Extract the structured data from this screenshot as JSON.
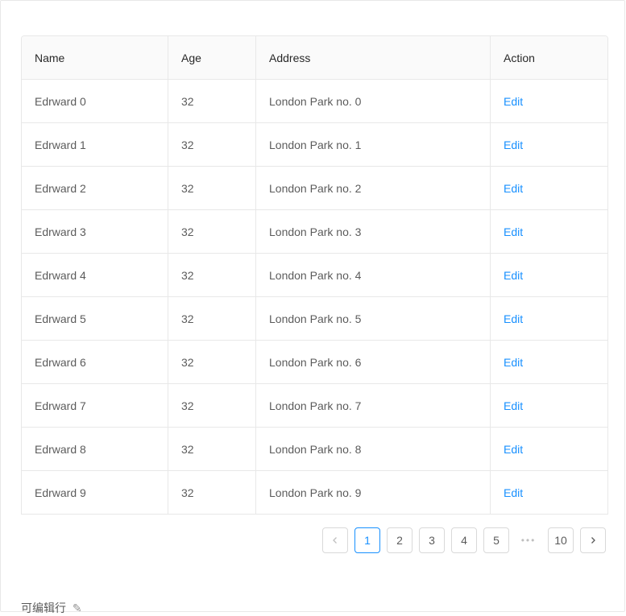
{
  "table": {
    "columns": [
      "Name",
      "Age",
      "Address",
      "Action"
    ],
    "rows": [
      {
        "name": "Edrward 0",
        "age": "32",
        "address": "London Park no. 0",
        "action": "Edit"
      },
      {
        "name": "Edrward 1",
        "age": "32",
        "address": "London Park no. 1",
        "action": "Edit"
      },
      {
        "name": "Edrward 2",
        "age": "32",
        "address": "London Park no. 2",
        "action": "Edit"
      },
      {
        "name": "Edrward 3",
        "age": "32",
        "address": "London Park no. 3",
        "action": "Edit"
      },
      {
        "name": "Edrward 4",
        "age": "32",
        "address": "London Park no. 4",
        "action": "Edit"
      },
      {
        "name": "Edrward 5",
        "age": "32",
        "address": "London Park no. 5",
        "action": "Edit"
      },
      {
        "name": "Edrward 6",
        "age": "32",
        "address": "London Park no. 6",
        "action": "Edit"
      },
      {
        "name": "Edrward 7",
        "age": "32",
        "address": "London Park no. 7",
        "action": "Edit"
      },
      {
        "name": "Edrward 8",
        "age": "32",
        "address": "London Park no. 8",
        "action": "Edit"
      },
      {
        "name": "Edrward 9",
        "age": "32",
        "address": "London Park no. 9",
        "action": "Edit"
      }
    ]
  },
  "pagination": {
    "pages": [
      "1",
      "2",
      "3",
      "4",
      "5"
    ],
    "ellipsis": "•••",
    "last_page": "10",
    "current": "1",
    "prev_icon": "chevron-left-icon",
    "next_icon": "chevron-right-icon"
  },
  "footer": {
    "title": "可编辑行",
    "icon": "edit-icon"
  },
  "colors": {
    "accent": "#1890ff",
    "border": "#e8e8e8",
    "header_bg": "#fafafa"
  }
}
